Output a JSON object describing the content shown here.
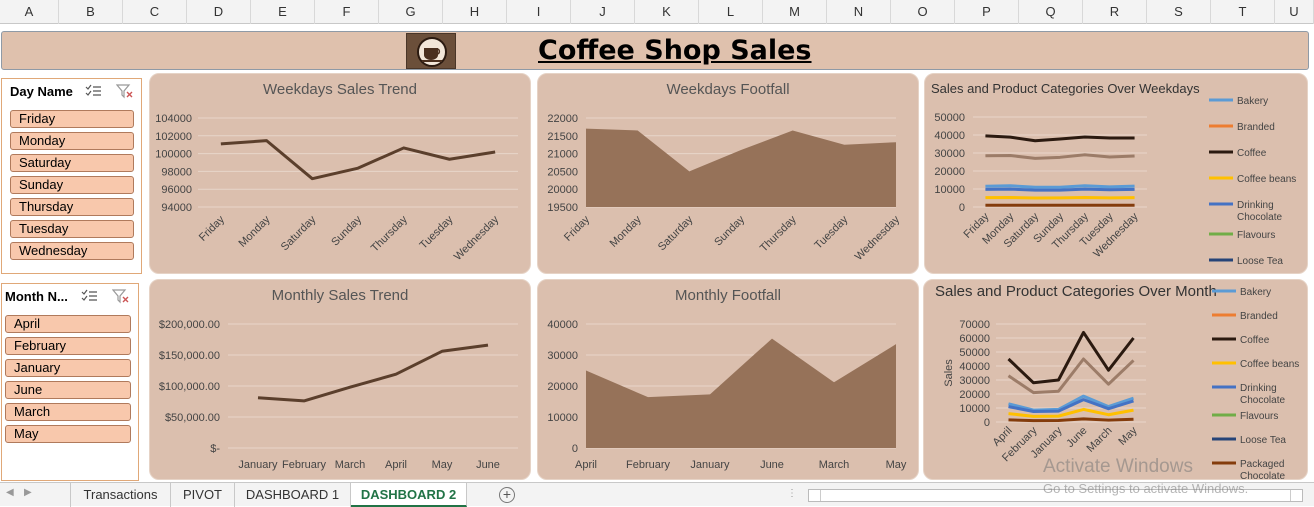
{
  "columns": [
    "A",
    "B",
    "C",
    "D",
    "E",
    "F",
    "G",
    "H",
    "I",
    "J",
    "K",
    "L",
    "M",
    "N",
    "O",
    "P",
    "Q",
    "R",
    "S",
    "T",
    "U"
  ],
  "dashboard": {
    "title": "Coffee Shop Sales"
  },
  "slicers": {
    "day": {
      "header": "Day Name",
      "items": [
        "Friday",
        "Monday",
        "Saturday",
        "Sunday",
        "Thursday",
        "Tuesday",
        "Wednesday"
      ]
    },
    "month": {
      "header": "Month N...",
      "items": [
        "April",
        "February",
        "January",
        "June",
        "March",
        "May"
      ]
    }
  },
  "panels": {
    "weekday_sales": "Weekdays Sales Trend",
    "weekday_footfall": "Weekdays Footfall",
    "weekday_categories": "Sales and Product Categories Over Weekdays",
    "monthly_sales": "Monthly Sales Trend",
    "monthly_footfall": "Monthly Footfall",
    "monthly_categories": "Sales and Product Categories Over Month"
  },
  "chart_data": [
    {
      "type": "line",
      "title": "Weekdays Sales Trend",
      "categories": [
        "Friday",
        "Monday",
        "Saturday",
        "Sunday",
        "Thursday",
        "Tuesday",
        "Wednesday"
      ],
      "values": [
        101300,
        101700,
        97000,
        98300,
        100800,
        99400,
        100300
      ],
      "yticks": [
        "104000",
        "102000",
        "100000",
        "98000",
        "96000",
        "94000"
      ],
      "ylim": [
        93500,
        104500
      ],
      "color": "#5b3f2c"
    },
    {
      "type": "area",
      "title": "Weekdays Footfall",
      "categories": [
        "Friday",
        "Monday",
        "Saturday",
        "Sunday",
        "Thursday",
        "Tuesday",
        "Wednesday"
      ],
      "values": [
        21700,
        21650,
        20500,
        21100,
        21650,
        21250,
        21320
      ],
      "yticks": [
        "22000",
        "21500",
        "21000",
        "20500",
        "20000",
        "19500"
      ],
      "ylim": [
        19500,
        22000
      ],
      "color": "#967259"
    },
    {
      "type": "line",
      "title": "Sales and Product Categories Over Weekdays",
      "categories": [
        "Friday",
        "Monday",
        "Saturday",
        "Sunday",
        "Thursday",
        "Tuesday",
        "Wednesday"
      ],
      "yticks": [
        "50000",
        "40000",
        "30000",
        "20000",
        "10000",
        "0"
      ],
      "ylim": [
        0,
        50000
      ],
      "legend": [
        "Bakery",
        "Branded",
        "Coffee",
        "Coffee beans",
        "Drinking Chocolate",
        "Flavours",
        "Loose Tea"
      ],
      "series": [
        {
          "values": [
            39500,
            38800,
            36800,
            37800,
            38900,
            38300,
            38300
          ],
          "color": "#2b1a10"
        },
        {
          "values": [
            28500,
            28600,
            27000,
            27600,
            29000,
            27800,
            28300
          ],
          "color": "#9c7c68"
        },
        {
          "values": [
            11500,
            11800,
            11000,
            11000,
            11800,
            11200,
            11600
          ],
          "color": "#5b9bd5"
        },
        {
          "values": [
            9800,
            9900,
            9400,
            9400,
            9900,
            9600,
            9800
          ],
          "color": "#4472c4"
        },
        {
          "values": [
            5200,
            5300,
            5000,
            5100,
            5300,
            5100,
            5200
          ],
          "color": "#ffc000"
        },
        {
          "values": [
            1000,
            1000,
            950,
            950,
            1000,
            980,
            1000
          ],
          "color": "#843c0c"
        }
      ]
    },
    {
      "type": "line",
      "title": "Monthly Sales Trend",
      "categories": [
        "January",
        "February",
        "March",
        "April",
        "May",
        "June"
      ],
      "values": [
        81000,
        76000,
        98000,
        119000,
        156000,
        166000
      ],
      "yticks": [
        "$200,000.00",
        "$150,000.00",
        "$100,000.00",
        "$50,000.00",
        "$-"
      ],
      "ylim": [
        0,
        200000
      ],
      "color": "#5b3f2c"
    },
    {
      "type": "area",
      "title": "Monthly Footfall",
      "categories": [
        "April",
        "February",
        "January",
        "June",
        "March",
        "May"
      ],
      "values": [
        25000,
        16400,
        17300,
        35300,
        21200,
        33500
      ],
      "yticks": [
        "40000",
        "30000",
        "20000",
        "10000",
        "0"
      ],
      "ylim": [
        0,
        40000
      ],
      "color": "#967259"
    },
    {
      "type": "line",
      "title": "Sales and Product Categories Over Month",
      "ylabel": "Sales",
      "categories": [
        "April",
        "February",
        "January",
        "June",
        "March",
        "May"
      ],
      "yticks": [
        "70000",
        "60000",
        "50000",
        "40000",
        "30000",
        "20000",
        "10000",
        "0"
      ],
      "ylim": [
        0,
        70000
      ],
      "legend": [
        "Bakery",
        "Branded",
        "Coffee",
        "Coffee beans",
        "Drinking Chocolate",
        "Flavours",
        "Loose Tea",
        "Packaged Chocolate"
      ],
      "series": [
        {
          "values": [
            45000,
            28000,
            30000,
            64000,
            37000,
            60000
          ],
          "color": "#2b1a10"
        },
        {
          "values": [
            33000,
            21000,
            22000,
            45000,
            27000,
            44000
          ],
          "color": "#9c7c68"
        },
        {
          "values": [
            13000,
            8500,
            9000,
            18500,
            11000,
            17000
          ],
          "color": "#5b9bd5"
        },
        {
          "values": [
            11000,
            7500,
            7800,
            16000,
            9500,
            15000
          ],
          "color": "#4472c4"
        },
        {
          "values": [
            6000,
            4000,
            4200,
            9000,
            5200,
            8500
          ],
          "color": "#ffc000"
        },
        {
          "values": [
            1500,
            1000,
            1100,
            2200,
            1300,
            2000
          ],
          "color": "#843c0c"
        }
      ]
    }
  ],
  "sheets": [
    "Transactions",
    "PIVOT",
    "DASHBOARD 1",
    "DASHBOARD 2"
  ],
  "active_sheet": "DASHBOARD 2",
  "watermark": {
    "line1": "Activate Windows",
    "line2": "Go to Settings to activate Windows."
  }
}
